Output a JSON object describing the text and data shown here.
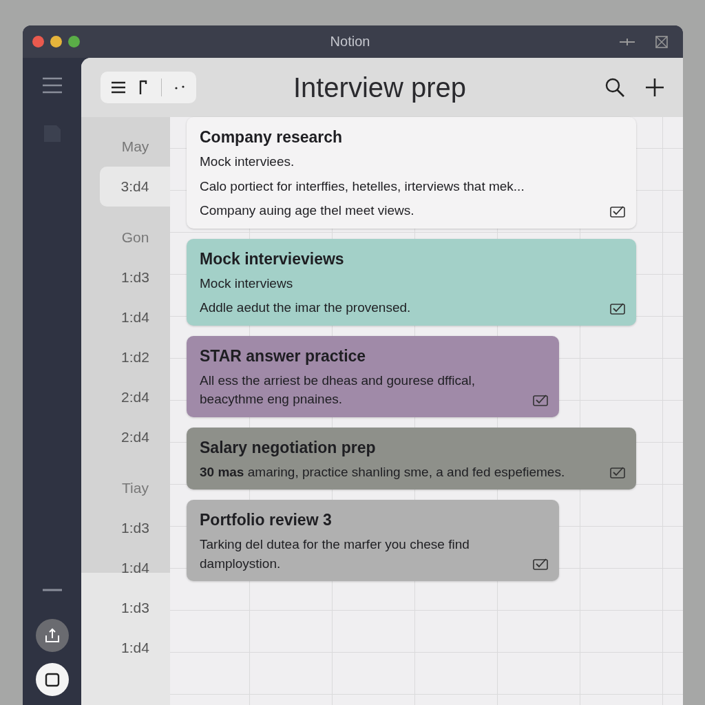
{
  "window": {
    "title": "Notion"
  },
  "page": {
    "title": "Interview prep"
  },
  "time_column": [
    {
      "label": "May",
      "kind": "month",
      "selected": false
    },
    {
      "label": "3:d4",
      "kind": "time",
      "selected": true
    },
    {
      "label": "Gon",
      "kind": "month",
      "selected": false
    },
    {
      "label": "1:d3",
      "kind": "time",
      "selected": false
    },
    {
      "label": "1:d4",
      "kind": "time",
      "selected": false
    },
    {
      "label": "1:d2",
      "kind": "time",
      "selected": false
    },
    {
      "label": "2:d4",
      "kind": "time",
      "selected": false
    },
    {
      "label": "2:d4",
      "kind": "time",
      "selected": false
    },
    {
      "label": "Tiay",
      "kind": "month",
      "selected": false
    },
    {
      "label": "1:d3",
      "kind": "time",
      "selected": false
    },
    {
      "label": "1:d4",
      "kind": "time",
      "selected": false
    },
    {
      "label": "1:d3",
      "kind": "time",
      "selected": false
    },
    {
      "label": "1:d4",
      "kind": "time",
      "selected": false
    }
  ],
  "cards": [
    {
      "title": "Company research",
      "color": "#f4f3f4",
      "lines": [
        "Mock interviees.",
        "Calo portiect for interffies, hetelles, irterviews that mek...",
        "Company auing age thel meet views."
      ]
    },
    {
      "title": "Mock intervieviews",
      "color": "#a3d0c8",
      "lines": [
        "Mock interviews",
        "Addle aedut the imar the provensed."
      ]
    },
    {
      "title": "STAR answer practice",
      "color": "#a08aa8",
      "lines": [
        "All ess the arriest be dheas and gourese dffical, beacythme eng pnaines."
      ]
    },
    {
      "title": "Salary negotiation prep",
      "color": "#8e908a",
      "lines": [
        "**30 mas** amaring, practice shanling sme, a and fed espefiemes."
      ]
    },
    {
      "title": "Portfolio review  3",
      "color": "#b0b0b0",
      "lines": [
        "Tarking del dutea for the marfer you chese find damploystion."
      ]
    }
  ]
}
